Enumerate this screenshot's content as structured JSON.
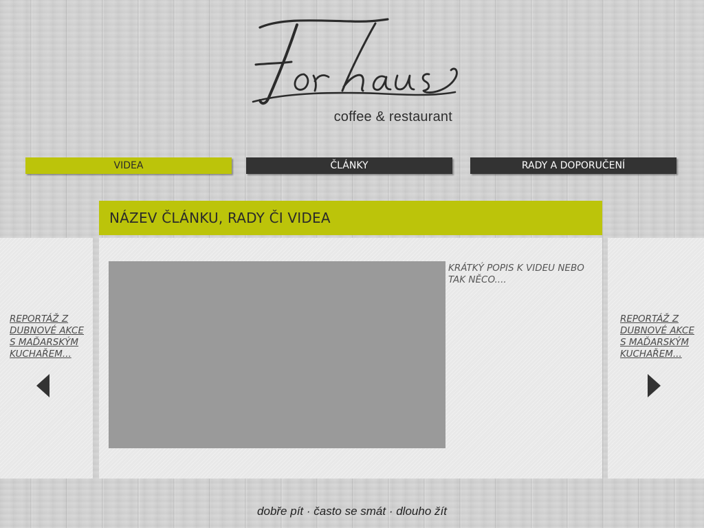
{
  "logo": {
    "brand": "Forhaus",
    "subtitle": "coffee & restaurant"
  },
  "nav": {
    "tabs": [
      {
        "label": "VIDEA",
        "active": true
      },
      {
        "label": "ČLÁNKY",
        "active": false
      },
      {
        "label": "RADY A DOPORUČENÍ",
        "active": false
      }
    ]
  },
  "article": {
    "title": "NÁZEV ČLÁNKU, RADY ČI VIDEA",
    "description": "KRÁTKÝ POPIS K VIDEU NEBO TAK NĚCO...."
  },
  "prev": {
    "link": "REPORTÁŽ Z DUBNOVÉ AKCE S MAĎARSKÝM KUCHAŘEM...",
    "arrow_icon": "arrow-left-icon"
  },
  "next": {
    "link": "REPORTÁŽ Z DUBNOVÉ AKCE S MAĎARSKÝM KUCHAŘEM...",
    "arrow_icon": "arrow-right-icon"
  },
  "footer": {
    "tagline": "dobře pít · často se smát · dlouho žít"
  },
  "colors": {
    "accent": "#bcc40a",
    "nav_dark": "#333333",
    "video_placeholder": "#9a9a9a",
    "panel": "#e8e8e8"
  }
}
